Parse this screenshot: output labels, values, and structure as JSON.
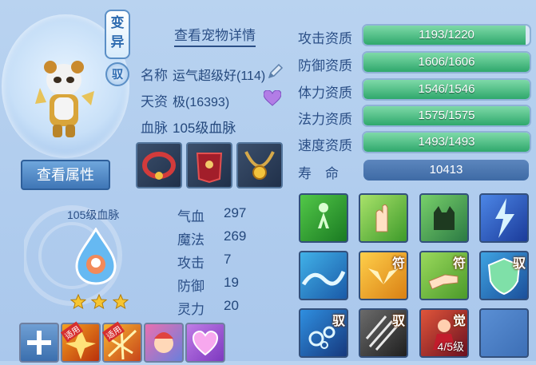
{
  "pet": {
    "mutation_badge": "变异",
    "driver_badge": "驭",
    "detail_link": "查看宠物详情",
    "view_attributes_button": "查看属性",
    "name_label": "名称",
    "name_value": "运气超级好(114)",
    "talent_label": "天资",
    "talent_value": "极(16393)",
    "bloodline_label": "血脉",
    "bloodline_value": "105级血脉",
    "bloodline_caption": "105级血脉",
    "stars": 3
  },
  "equipment": [
    {
      "icon": "red-collar-icon"
    },
    {
      "icon": "red-armor-icon"
    },
    {
      "icon": "gold-necklace-icon"
    }
  ],
  "stats": [
    {
      "label": "气血",
      "value": "297"
    },
    {
      "label": "魔法",
      "value": "269"
    },
    {
      "label": "攻击",
      "value": "7"
    },
    {
      "label": "防御",
      "value": "19"
    },
    {
      "label": "灵力",
      "value": "20"
    }
  ],
  "bottom_slots": [
    {
      "icon": "add-plus-icon",
      "tag": ""
    },
    {
      "icon": "fire-rune-icon",
      "tag": "适用"
    },
    {
      "icon": "flame-burst-icon",
      "tag": "适用"
    },
    {
      "icon": "pet-portrait-icon",
      "tag": ""
    },
    {
      "icon": "heart-gem-icon",
      "tag": ""
    }
  ],
  "aptitudes": [
    {
      "label": "攻击资质",
      "text": "1193/1220",
      "fill": 0.978
    },
    {
      "label": "防御资质",
      "text": "1606/1606",
      "fill": 1.0
    },
    {
      "label": "体力资质",
      "text": "1546/1546",
      "fill": 1.0
    },
    {
      "label": "法力资质",
      "text": "1575/1575",
      "fill": 1.0
    },
    {
      "label": "速度资质",
      "text": "1493/1493",
      "fill": 1.0
    }
  ],
  "lifespan": {
    "label": "寿　命",
    "value": "10413"
  },
  "skills": [
    {
      "icon": "green-figure-icon",
      "tag": "",
      "level": ""
    },
    {
      "icon": "palm-strike-icon",
      "tag": "",
      "level": ""
    },
    {
      "icon": "shadow-cat-icon",
      "tag": "",
      "level": ""
    },
    {
      "icon": "lightning-icon",
      "tag": "",
      "level": ""
    },
    {
      "icon": "water-wave-icon",
      "tag": "",
      "level": ""
    },
    {
      "icon": "golden-wings-icon",
      "tag": "符",
      "level": ""
    },
    {
      "icon": "pointing-hand-icon",
      "tag": "符",
      "level": ""
    },
    {
      "icon": "shield-icon",
      "tag": "驭",
      "level": ""
    },
    {
      "icon": "bubbles-icon",
      "tag": "驭",
      "level": ""
    },
    {
      "icon": "claw-slash-icon",
      "tag": "驭",
      "level": ""
    },
    {
      "icon": "awakened-warrior-icon",
      "tag": "觉",
      "level": "4/5级"
    },
    {
      "icon": "empty-slot-icon",
      "tag": "",
      "level": ""
    }
  ],
  "colors": {
    "bar_fill": "#3fbf7f",
    "panel_bg": "#b9d3f0",
    "text": "#2b4f86"
  }
}
